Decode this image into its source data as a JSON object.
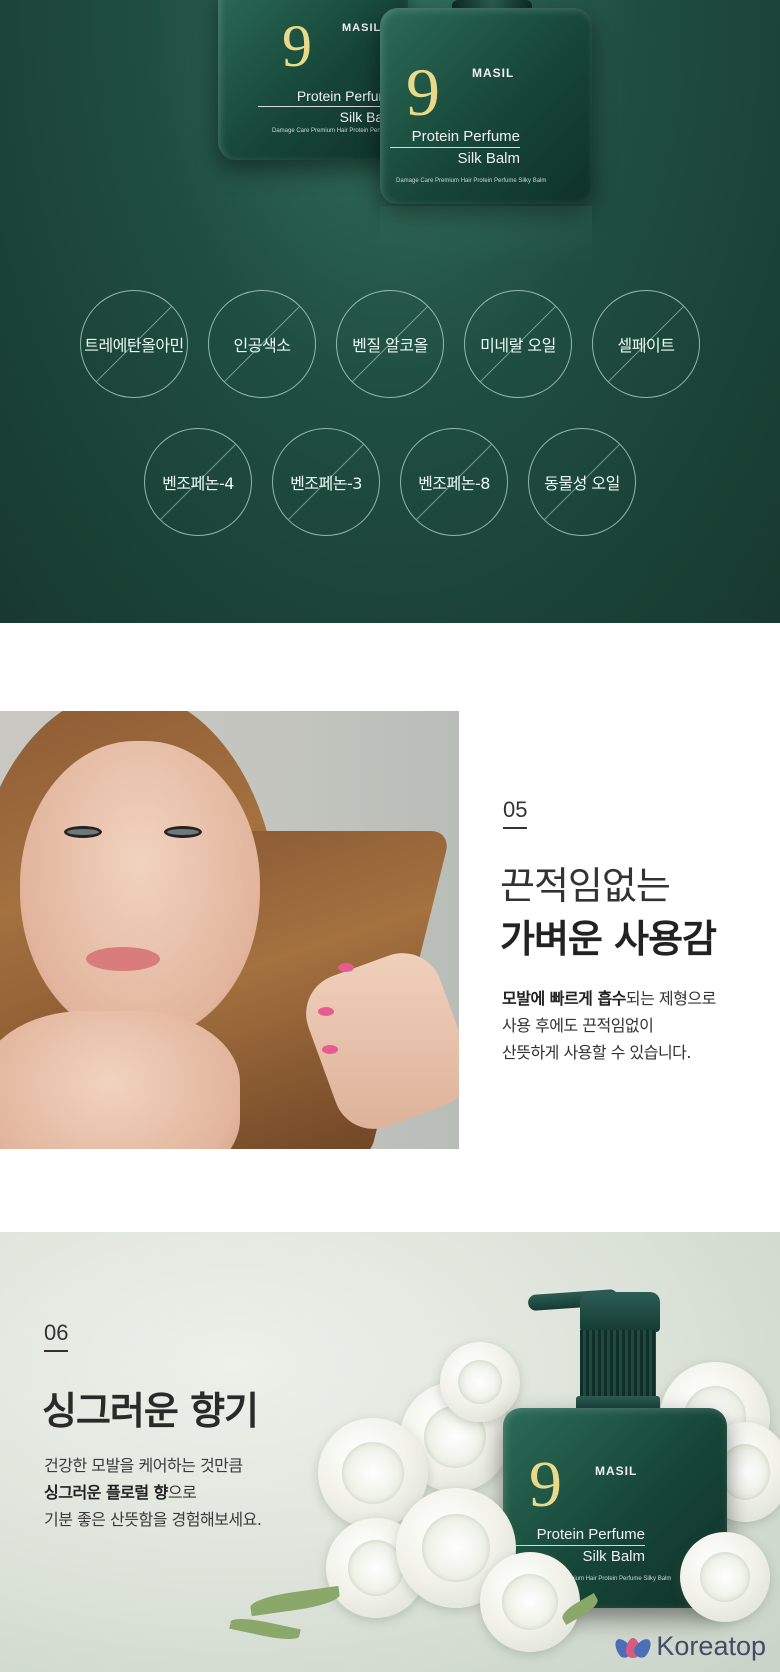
{
  "hero": {
    "bottle_back": {
      "number": "9",
      "brand": "MASIL",
      "name_line1": "Protein Perfume",
      "name_line2": "Silk Balm",
      "subtitle": "Damage Care Premium Hair Protein Perfume Silky Balm"
    },
    "bottle_front": {
      "number": "9",
      "brand": "MASIL",
      "name_line1": "Protein Perfume",
      "name_line2": "Silk Balm",
      "subtitle": "Damage Care Premium Hair Protein Perfume Silky Balm"
    },
    "free_from_row1": [
      "트레에탄올아민",
      "인공색소",
      "벤질 알코올",
      "미네랄 오일",
      "셀페이트"
    ],
    "free_from_row2": [
      "벤조페논-4",
      "벤조페논-3",
      "벤조페논-8",
      "동물성 오일"
    ]
  },
  "feature05": {
    "number": "05",
    "title_light": "끈적임없는",
    "title_bold": "가벼운 사용감",
    "line1_bold": "모발에 빠르게 흡수",
    "line1_rest": "되는 제형으로",
    "line2": "사용 후에도 끈적임없이",
    "line3": "산뜻하게 사용할 수 있습니다."
  },
  "feature06": {
    "number": "06",
    "title_bold": "싱그러운 향기",
    "line1": "건강한 모발을 케어하는 것만큼",
    "line2_bold": "싱그러운 플로럴 향",
    "line2_rest": "으로",
    "line3": "기분 좋은 산뜻함을 경험해보세요.",
    "bottle": {
      "number": "9",
      "brand": "MASIL",
      "name_line1": "Protein Perfume",
      "name_line2": "Silk Balm",
      "subtitle": "Damage Care Premium Hair Protein Perfume Silky Balm"
    }
  },
  "watermark": {
    "text": "Koreatop"
  },
  "colors": {
    "hero_green": "#1f4e40",
    "accent_gold": "#e9d98a",
    "text_dark": "#333333",
    "logo_navy": "#444b66"
  }
}
